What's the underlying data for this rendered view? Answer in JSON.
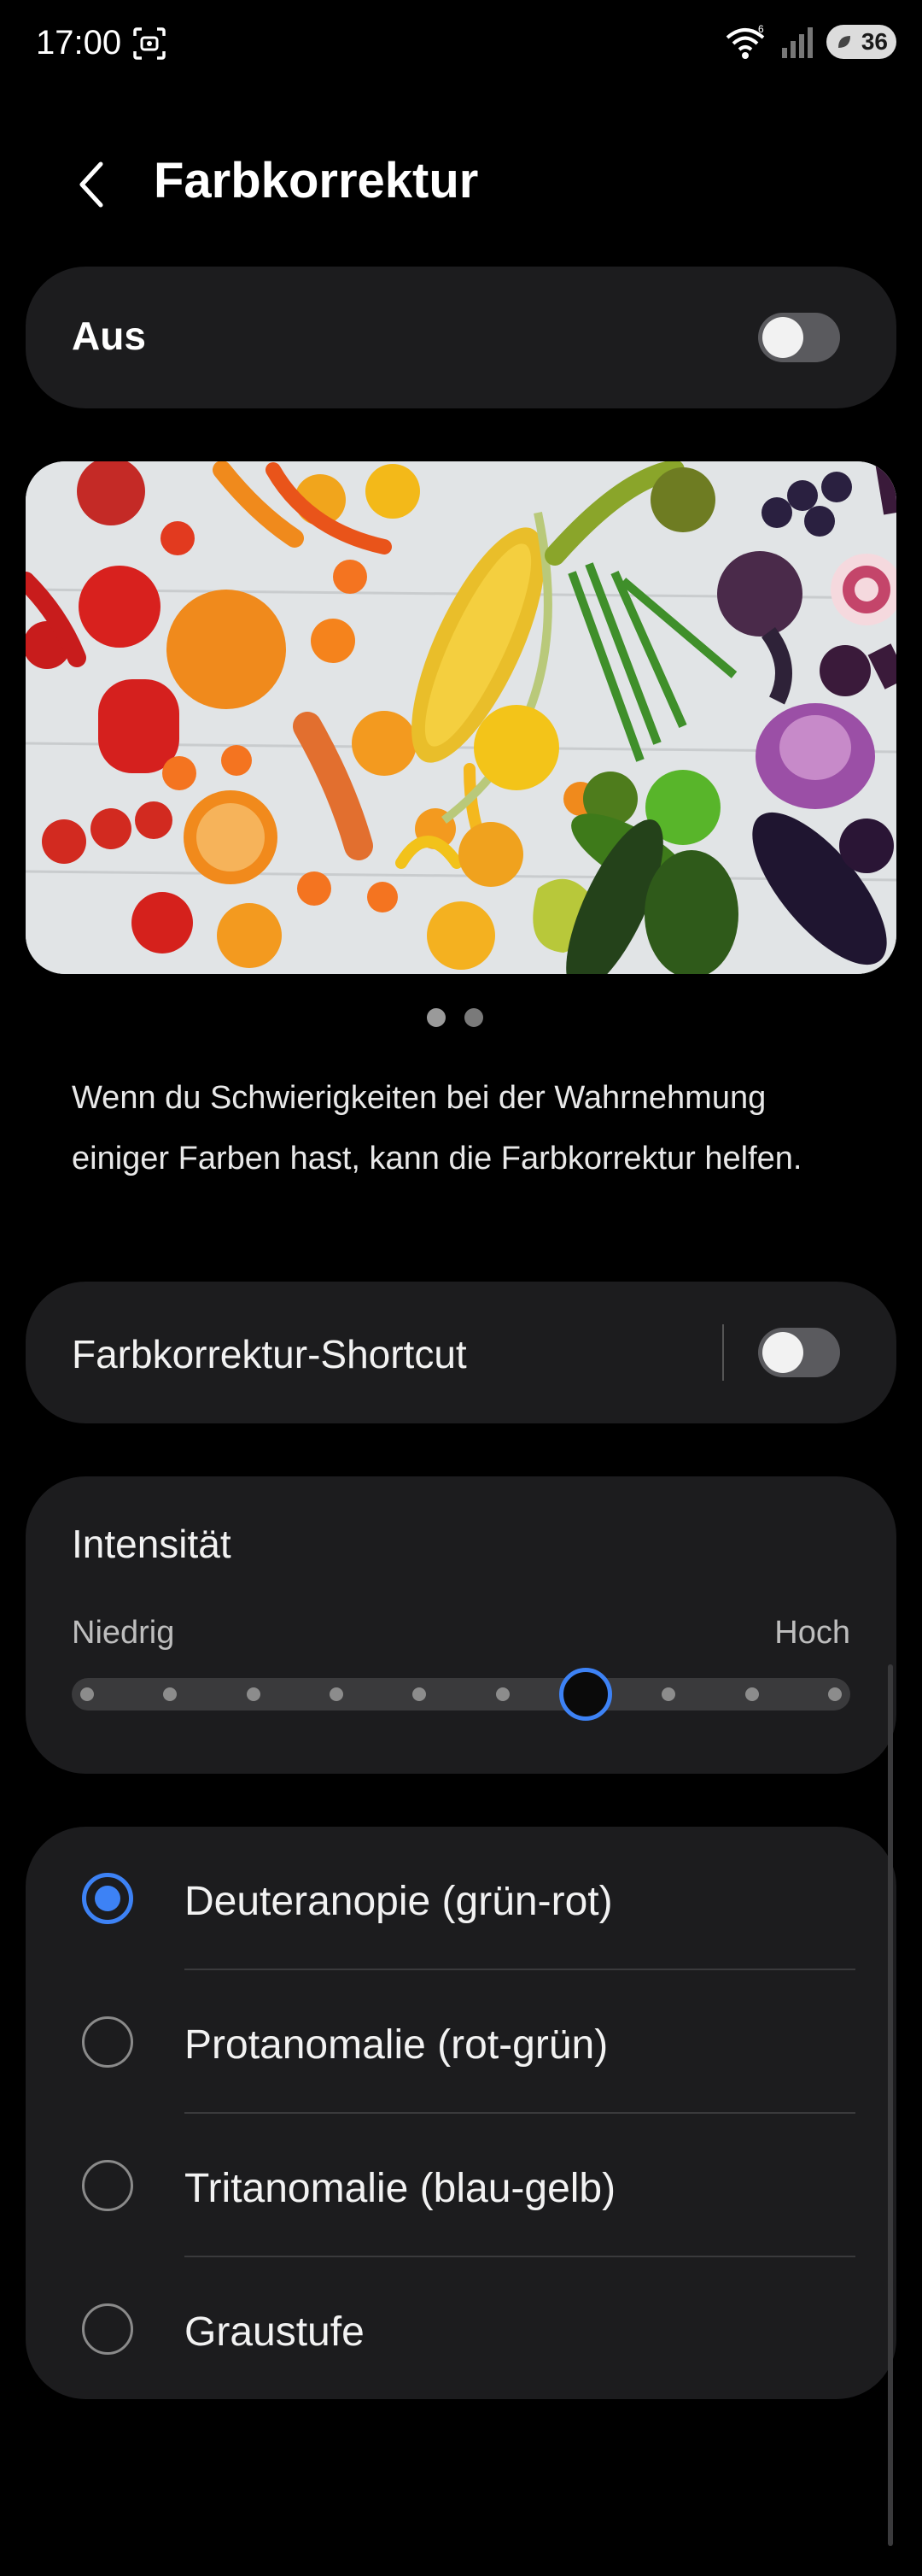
{
  "status_bar": {
    "time": "17:00",
    "icons": [
      "screenshot-icon",
      "wifi-icon",
      "signal-icon",
      "battery-icon"
    ],
    "battery_level": "36"
  },
  "header": {
    "back_icon": "chevron-left-icon",
    "title": "Farbkorrektur"
  },
  "master_switch": {
    "label": "Aus",
    "on": false
  },
  "preview": {
    "icon": "vegetables-image",
    "pages": 2,
    "current_page": 1
  },
  "description": "Wenn du Schwierigkeiten bei der Wahrnehmung einiger Farben hast, kann die Farbkorrektur helfen.",
  "shortcut": {
    "label": "Farbkorrektur-Shortcut",
    "on": false
  },
  "intensity": {
    "title": "Intensität",
    "low_label": "Niedrig",
    "high_label": "Hoch",
    "steps": 10,
    "value_step": 7
  },
  "modes": {
    "selected": 0,
    "items": [
      {
        "label": "Deuteranopie (grün-rot)"
      },
      {
        "label": "Protanomalie (rot-grün)"
      },
      {
        "label": "Tritanomalie (blau-gelb)"
      },
      {
        "label": "Graustufe"
      }
    ]
  },
  "colors": {
    "background": "#000000",
    "card": "#1c1c1e",
    "accent": "#3d82f5",
    "toggle_off": "#5a5a5e"
  }
}
